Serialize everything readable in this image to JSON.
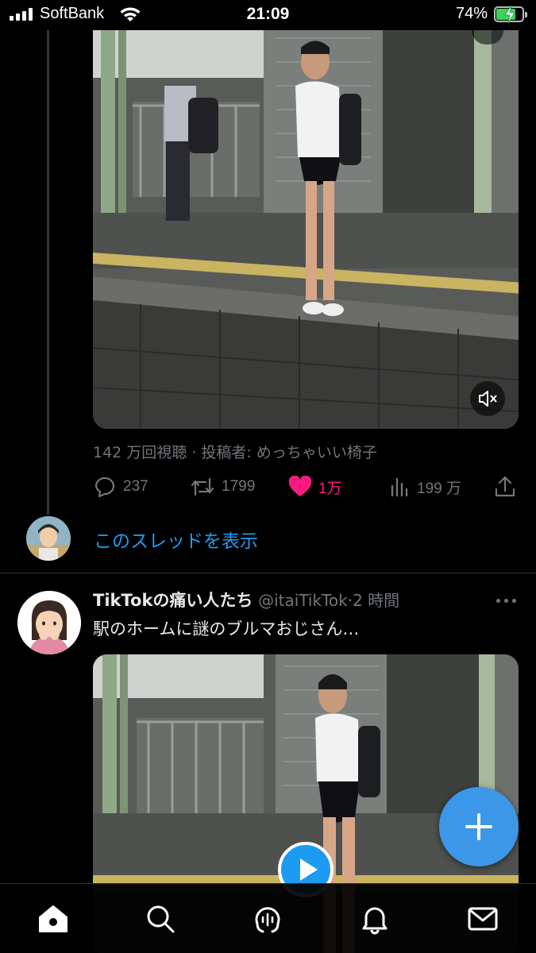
{
  "status_bar": {
    "carrier": "SoftBank",
    "time": "21:09",
    "battery_percent_text": "74%",
    "battery_level": 0.74,
    "icons": [
      "signal-icon",
      "wifi-icon",
      "battery-charging-icon"
    ]
  },
  "tweet_1": {
    "media_type": "video",
    "views_line": "142 万回視聴 · 投稿者: めっちゃいい椅子",
    "actions": {
      "reply_count": "237",
      "retweet_count": "1799",
      "like_count": "1万",
      "view_count": "199 万"
    },
    "liked": true,
    "like_color": "#f91880",
    "show_thread": "このスレッドを表示"
  },
  "tweet_2": {
    "display_name": "TikTokの痛い人たち",
    "handle": "@itaiTikTok",
    "separator": "·",
    "timestamp": "2 時間",
    "text": "駅のホームに謎のブルマおじさん…",
    "media_type": "video"
  },
  "colors": {
    "accent": "#1d9bf0",
    "muted_text": "#71767b",
    "fab": "#3d97e8"
  },
  "tab_bar": {
    "tabs": [
      "home-icon",
      "search-icon",
      "spaces-icon",
      "notifications-icon",
      "messages-icon"
    ],
    "active": "home-icon"
  }
}
